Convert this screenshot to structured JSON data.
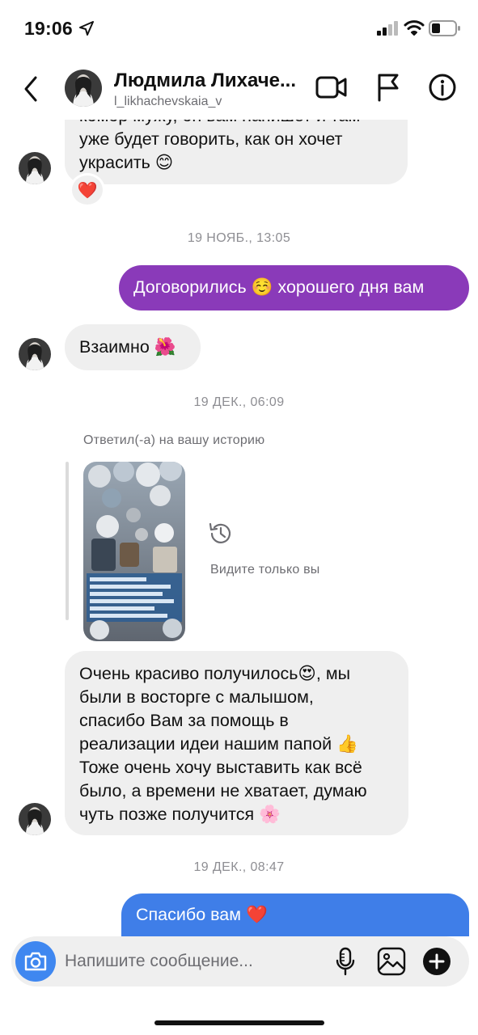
{
  "status_bar": {
    "time": "19:06",
    "icons": [
      "location-arrow-icon",
      "signal-icon",
      "wifi-icon",
      "battery-icon"
    ]
  },
  "header": {
    "contact_name": "Людмила Лихаче...",
    "username": "l_likhachevskaia_v",
    "icons": [
      "back-icon",
      "video-call-icon",
      "flag-icon",
      "info-icon"
    ]
  },
  "messages": {
    "m1": {
      "text": "комор мужу, он вам напишет и там\nуже будет говорить, как он хочет\nукрасить",
      "emoji": "😊",
      "reaction": "❤️"
    },
    "ts1": "19 НОЯБ., 13:05",
    "m2": {
      "text_before": "Договорились",
      "emoji": "☺️",
      "text_after": "хорошего дня вам"
    },
    "m3": {
      "text": "Взаимно",
      "emoji": "🌺"
    },
    "ts2": "19 ДЕК., 06:09",
    "story_reply": {
      "note": "Ответил(-а) на вашу историю",
      "unavailable_text": "Видите только вы"
    },
    "m4": {
      "line1": "Очень красиво получилось",
      "emoji1": "😍",
      "line1_end": ", мы",
      "line2": "были в восторге с малышом,",
      "line3": "спасибо Вам за помощь в",
      "line4": "реализации идеи нашим папой",
      "emoji2": "👍",
      "line5": "Тоже очень хочу выставить как всё",
      "line6": "было, а времени не хватает, думаю",
      "line7": "чуть позже получится",
      "emoji3": "🌸"
    },
    "ts3": "19 ДЕК., 08:47",
    "m5": {
      "text": "Спасибо вам",
      "emoji": "❤️"
    }
  },
  "composer": {
    "placeholder": "Напишите сообщение..."
  },
  "colors": {
    "outgoing_purple": "#8a3ab9",
    "outgoing_blue": "#3f7ee8",
    "incoming_gray": "#efefef",
    "camera_button": "#3f87f0"
  }
}
